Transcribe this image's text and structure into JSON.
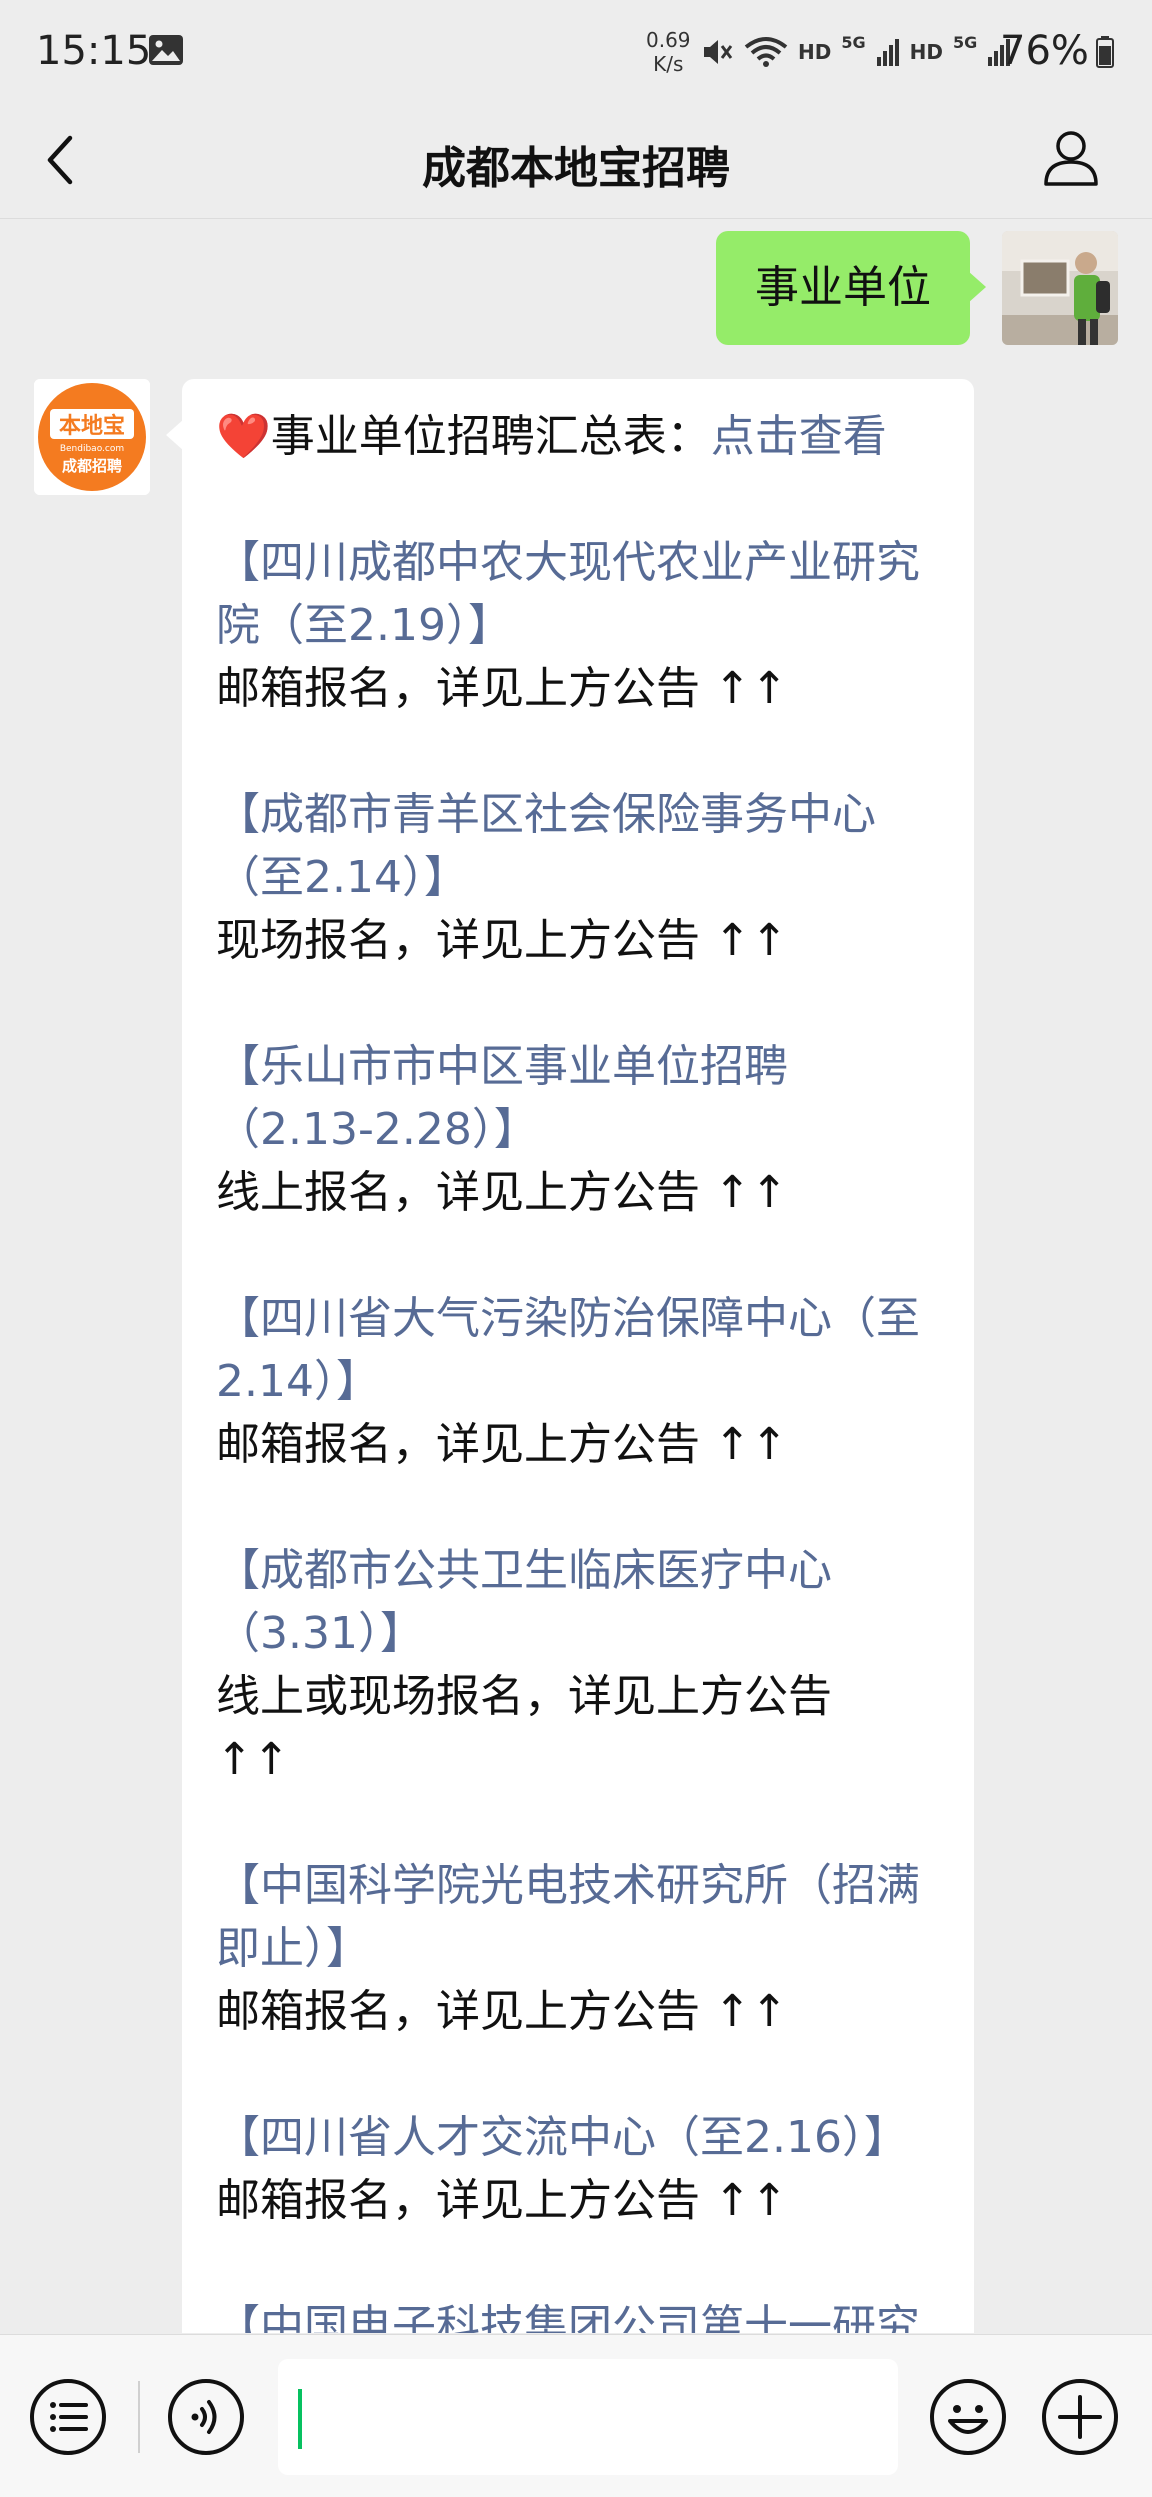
{
  "status_bar": {
    "time": "15:15",
    "net_speed_value": "0.69",
    "net_speed_unit": "K/s",
    "hd1": "HD",
    "g1": "5G",
    "hd2": "HD",
    "g2": "5G",
    "battery": "76%"
  },
  "header": {
    "title": "成都本地宝招聘"
  },
  "chat": {
    "sent_message": "事业单位",
    "received": {
      "summary_heart": "❤️",
      "summary_text": "事业单位招聘汇总表：",
      "summary_link": "点击查看",
      "entries": [
        {
          "lines": [
            "【四川成都中农大现代农业产业研究",
            "院（至2.19）】"
          ],
          "note": [
            "邮箱报名，详见上方公告 ↑↑"
          ]
        },
        {
          "lines": [
            "【成都市青羊区社会保险事务中心",
            "（至2.14）】"
          ],
          "note": [
            "现场报名，详见上方公告 ↑↑"
          ]
        },
        {
          "lines": [
            "【乐山市市中区事业单位招聘",
            "（2.13-2.28）】"
          ],
          "note": [
            "线上报名，详见上方公告 ↑↑"
          ]
        },
        {
          "lines": [
            "【四川省大气污染防治保障中心（至",
            "2.14）】"
          ],
          "note": [
            "邮箱报名，详见上方公告 ↑↑"
          ]
        },
        {
          "lines": [
            "【成都市公共卫生临床医疗中心",
            "（3.31）】"
          ],
          "note": [
            "线上或现场报名，详见上方公告",
            "↑↑"
          ]
        },
        {
          "lines": [
            "【中国科学院光电技术研究所（招满",
            "即止）】"
          ],
          "note": [
            "邮箱报名，详见上方公告 ↑↑"
          ]
        },
        {
          "lines": [
            "【四川省人才交流中心（至2.16）】"
          ],
          "note": [
            "邮箱报名，详见上方公告 ↑↑"
          ]
        },
        {
          "lines": [
            "【中国电子科技集团公司第十一研究"
          ],
          "note": []
        }
      ]
    },
    "avatar_left_text_top": "本地宝",
    "avatar_left_text_mid": "Bendibao.com",
    "avatar_left_text_bottom": "成都招聘"
  },
  "colors": {
    "background": "#ededed",
    "sent_bubble": "#95ec69",
    "link": "#576b95",
    "cursor": "#07c160",
    "brand_orange": "#f47b20"
  }
}
